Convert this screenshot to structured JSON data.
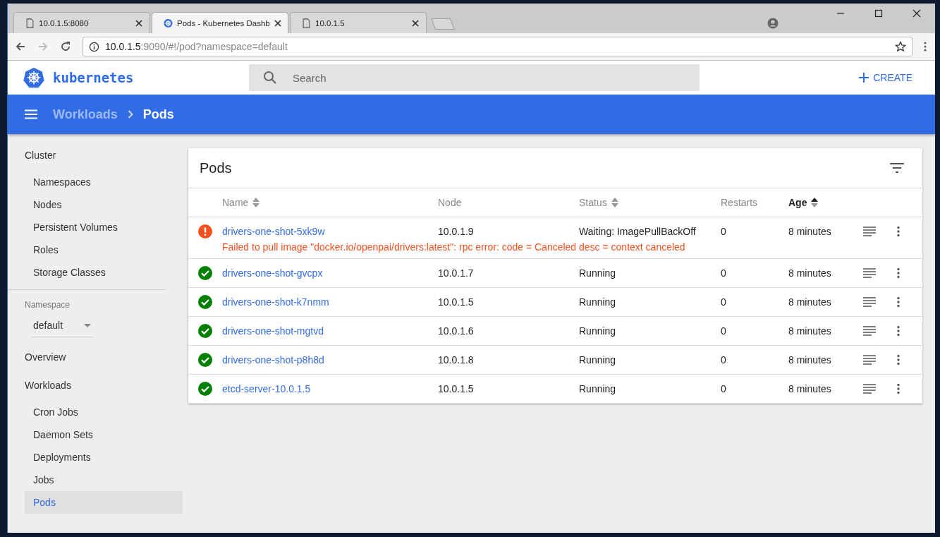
{
  "browser": {
    "tabs": [
      {
        "title": "10.0.1.5:8080",
        "kind": "page",
        "selected": false
      },
      {
        "title": "Pods - Kubernetes Dashb",
        "kind": "kubernetes",
        "selected": true
      },
      {
        "title": "10.0.1.5",
        "kind": "page",
        "selected": false
      }
    ],
    "address": {
      "host": "10.0.1.5",
      "rest": ":9090/#!/pod?namespace=default"
    }
  },
  "header": {
    "logo": "kubernetes",
    "search": {
      "placeholder": "Search"
    },
    "create": "CREATE"
  },
  "breadcrumb": {
    "parent": "Workloads",
    "current": "Pods"
  },
  "sidebar": {
    "sections": [
      {
        "title": "Cluster",
        "items": [
          {
            "label": "Namespaces",
            "selected": false
          },
          {
            "label": "Nodes",
            "selected": false
          },
          {
            "label": "Persistent Volumes",
            "selected": false
          },
          {
            "label": "Roles",
            "selected": false
          },
          {
            "label": "Storage Classes",
            "selected": false
          }
        ]
      },
      {
        "kind": "namespace",
        "label": "Namespace",
        "value": "default"
      },
      {
        "title": "Overview"
      },
      {
        "title": "Workloads",
        "items": [
          {
            "label": "Cron Jobs",
            "selected": false
          },
          {
            "label": "Daemon Sets",
            "selected": false
          },
          {
            "label": "Deployments",
            "selected": false
          },
          {
            "label": "Jobs",
            "selected": false
          },
          {
            "label": "Pods",
            "selected": true
          }
        ]
      }
    ]
  },
  "card": {
    "title": "Pods",
    "columns": [
      {
        "label": "Name",
        "sortable": true,
        "sorted": false
      },
      {
        "label": "Node",
        "sortable": false,
        "sorted": false
      },
      {
        "label": "Status",
        "sortable": true,
        "sorted": false
      },
      {
        "label": "Restarts",
        "sortable": false,
        "sorted": false
      },
      {
        "label": "Age",
        "sortable": true,
        "sorted": true
      }
    ],
    "rows": [
      {
        "kind": "error",
        "name": "drivers-one-shot-5xk9w",
        "node": "10.0.1.9",
        "status": "Waiting: ImagePullBackOff",
        "restarts": "0",
        "age": "8 minutes",
        "message": "Failed to pull image \"docker.io/openpai/drivers:latest\": rpc error: code = Canceled desc = context canceled"
      },
      {
        "kind": "ok",
        "name": "drivers-one-shot-gvcpx",
        "node": "10.0.1.7",
        "status": "Running",
        "restarts": "0",
        "age": "8 minutes"
      },
      {
        "kind": "ok",
        "name": "drivers-one-shot-k7nmm",
        "node": "10.0.1.5",
        "status": "Running",
        "restarts": "0",
        "age": "8 minutes"
      },
      {
        "kind": "ok",
        "name": "drivers-one-shot-mgtvd",
        "node": "10.0.1.6",
        "status": "Running",
        "restarts": "0",
        "age": "8 minutes"
      },
      {
        "kind": "ok",
        "name": "drivers-one-shot-p8h8d",
        "node": "10.0.1.8",
        "status": "Running",
        "restarts": "0",
        "age": "8 minutes"
      },
      {
        "kind": "ok",
        "name": "etcd-server-10.0.1.5",
        "node": "10.0.1.5",
        "status": "Running",
        "restarts": "0",
        "age": "8 minutes"
      }
    ]
  }
}
